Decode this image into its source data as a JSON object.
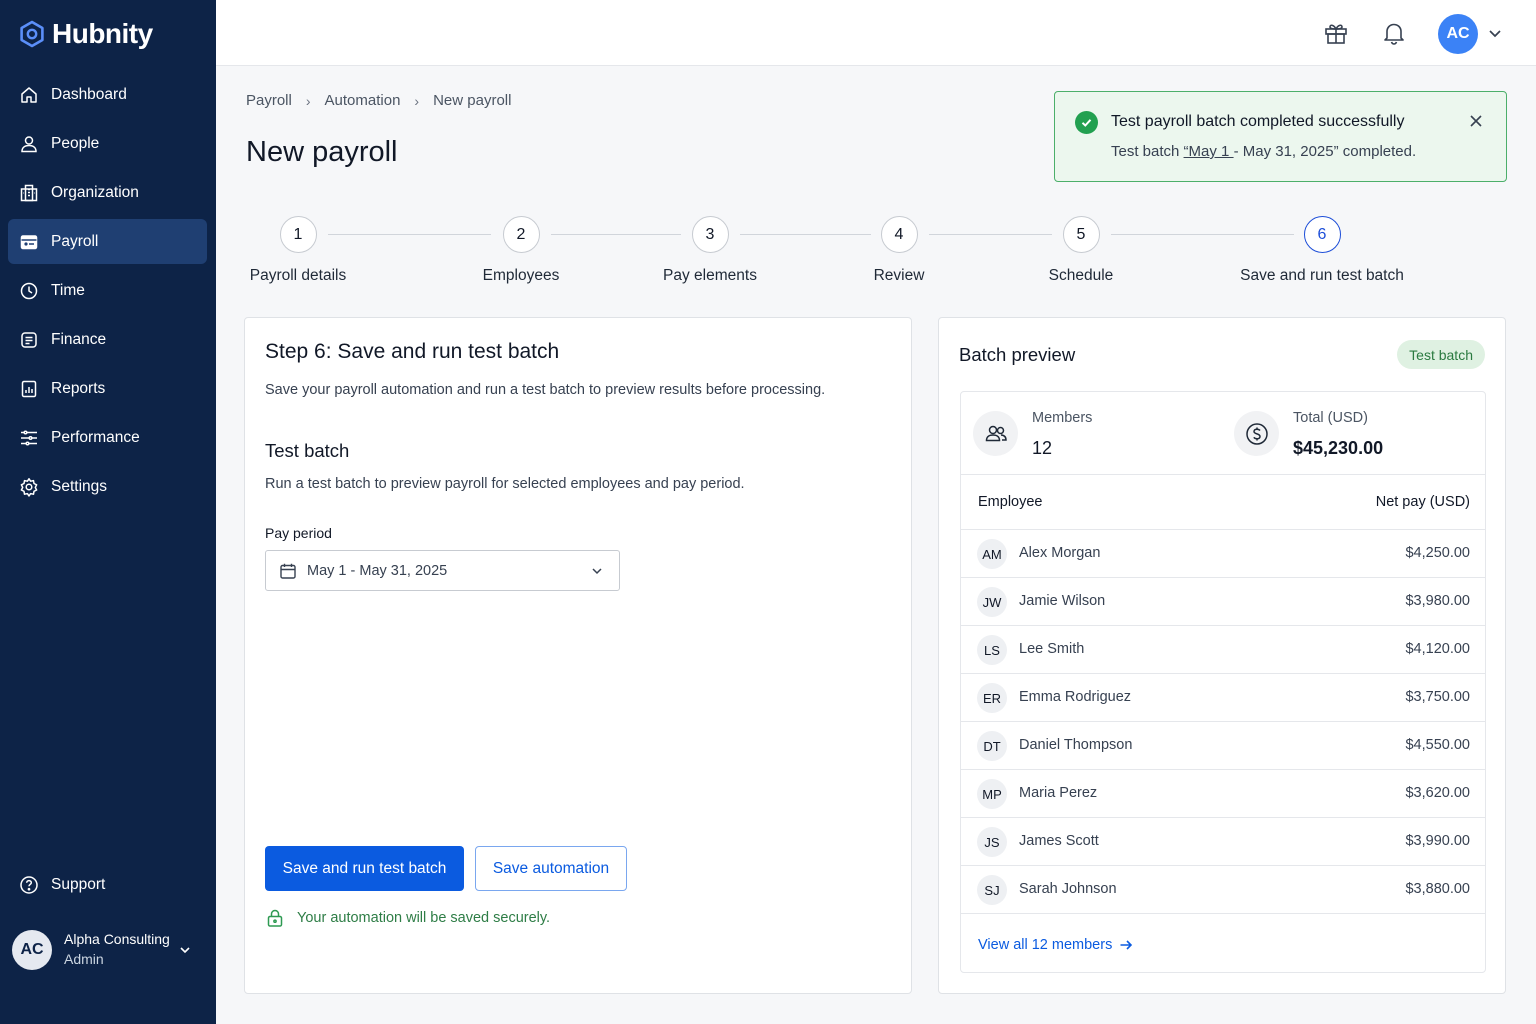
{
  "brand": {
    "name": "Hubnity"
  },
  "sidebar": {
    "items": [
      {
        "label": "Dashboard",
        "icon": "home-icon"
      },
      {
        "label": "People",
        "icon": "person-icon"
      },
      {
        "label": "Organization",
        "icon": "building-icon"
      },
      {
        "label": "Payroll",
        "icon": "payroll-icon",
        "active": true
      },
      {
        "label": "Time",
        "icon": "clock-icon"
      },
      {
        "label": "Finance",
        "icon": "finance-icon"
      },
      {
        "label": "Reports",
        "icon": "report-icon"
      },
      {
        "label": "Performance",
        "icon": "performance-icon"
      },
      {
        "label": "Settings",
        "icon": "gear-icon"
      }
    ],
    "support_label": "Support",
    "account": {
      "initials": "AC",
      "name": "Alpha Consulting",
      "role": "Admin"
    }
  },
  "topbar": {
    "avatar_initials": "AC"
  },
  "breadcrumb": [
    "Payroll",
    "Automation",
    "New payroll"
  ],
  "page_title": "New payroll",
  "toast": {
    "title": "Test payroll batch completed successfully",
    "sub_prefix": "Test batch ",
    "sub_link": "“May 1 ",
    "sub_suffix": "- May 31, 2025” completed."
  },
  "steps": [
    {
      "num": "1",
      "label": "Payroll details"
    },
    {
      "num": "2",
      "label": "Employees"
    },
    {
      "num": "3",
      "label": "Pay elements"
    },
    {
      "num": "4",
      "label": "Review"
    },
    {
      "num": "5",
      "label": "Schedule"
    },
    {
      "num": "6",
      "label": "Save and run test batch",
      "active": true
    }
  ],
  "left_card": {
    "title": "Step 6: Save and run test batch",
    "subtitle": "Save your payroll automation and run a test batch to preview results before processing.",
    "section_title": "Test batch",
    "section_subtitle": "Run a test batch to preview payroll for selected employees and pay period.",
    "pay_period_label": "Pay period",
    "pay_period_value": "May 1 - May 31, 2025",
    "primary_button": "Save and run test batch",
    "secondary_button": "Save automation",
    "secure_note": "Your automation will be saved securely."
  },
  "right_card": {
    "title": "Batch preview",
    "badge": "Test batch",
    "members_label": "Members",
    "members_value": "12",
    "total_label": "Total (USD)",
    "total_value": "$45,230.00",
    "col_employee": "Employee",
    "col_net_pay": "Net pay (USD)",
    "rows": [
      {
        "initials": "AM",
        "name": "Alex Morgan",
        "pay": "$4,250.00"
      },
      {
        "initials": "JW",
        "name": "Jamie Wilson",
        "pay": "$3,980.00"
      },
      {
        "initials": "LS",
        "name": "Lee Smith",
        "pay": "$4,120.00"
      },
      {
        "initials": "ER",
        "name": "Emma Rodriguez",
        "pay": "$3,750.00"
      },
      {
        "initials": "DT",
        "name": "Daniel Thompson",
        "pay": "$4,550.00"
      },
      {
        "initials": "MP",
        "name": "Maria Perez",
        "pay": "$3,620.00"
      },
      {
        "initials": "JS",
        "name": "James Scott",
        "pay": "$3,990.00"
      },
      {
        "initials": "SJ",
        "name": "Sarah Johnson",
        "pay": "$3,880.00"
      }
    ],
    "view_all": "View all 12 members"
  },
  "colors": {
    "sidebar_bg": "#0d2347",
    "primary": "#0b5be0",
    "success": "#22a050"
  }
}
